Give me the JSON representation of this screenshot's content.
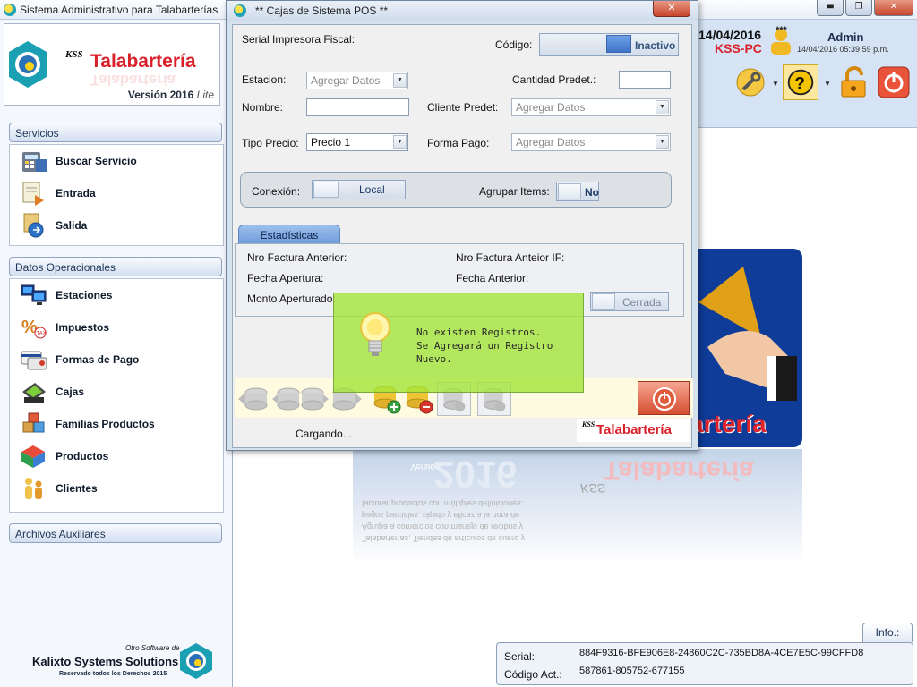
{
  "main_window": {
    "title": "Sistema Administrativo para Talabarterías",
    "controls": {
      "minimize": "▬",
      "maximize": "❐",
      "close": "✕"
    }
  },
  "logo": {
    "kss": "KSS",
    "name": "Talabartería",
    "version_label": "Versión 2016",
    "edition": "Lite"
  },
  "sidebar": {
    "servicios": {
      "header": "Servicios",
      "items": [
        {
          "label": "Buscar Servicio",
          "icon": "calculator-icon"
        },
        {
          "label": "Entrada",
          "icon": "document-in-icon"
        },
        {
          "label": "Salida",
          "icon": "document-out-icon"
        }
      ]
    },
    "datos": {
      "header": "Datos Operacionales",
      "items": [
        {
          "label": "Estaciones",
          "icon": "computers-icon"
        },
        {
          "label": "Impuestos",
          "icon": "percent-icon"
        },
        {
          "label": "Formas de Pago",
          "icon": "credit-card-icon"
        },
        {
          "label": "Cajas",
          "icon": "cash-register-icon"
        },
        {
          "label": "Familias Productos",
          "icon": "boxes-icon"
        },
        {
          "label": "Productos",
          "icon": "products-icon"
        },
        {
          "label": "Clientes",
          "icon": "people-icon"
        }
      ]
    },
    "auxiliares": {
      "header": "Archivos Auxiliares"
    }
  },
  "footer": {
    "small": "Otro Software de",
    "company": "Kalixto Systems Solutions",
    "rights": "Reservado todos los Derechos 2015"
  },
  "header": {
    "date": "14/04/2016",
    "pc": "KSS-PC",
    "stars": "***",
    "user": "Admin",
    "timestamp": "14/04/2016 05:39:59 p.m."
  },
  "splash": {
    "brand": "artería",
    "reflect_year": "2016",
    "reflect_version": "Versión",
    "reflect_brand": "Talabartería",
    "reflect_kss": "KSS",
    "reflect_lines": "Talabarterías, Tiendas de artículos de cuero y Agrupa a comercios con manejo de recibos y pagos parciales, rápido y eficaz a la hora de facturar productos con múltiples definiciones."
  },
  "info_tab": "Info.:",
  "serial": {
    "serial_label": "Serial:",
    "serial_value": "884F9316-BFE906E8-24860C2C-735BD8A-4CE7E5C-99CFFD8",
    "code_label": "Código Act.:",
    "code_value": "587861-805752-677155"
  },
  "pos_dialog": {
    "title": "** Cajas de Sistema POS **",
    "close": "✕",
    "serial_impresora": "Serial Impresora Fiscal:",
    "codigo_label": "Código:",
    "codigo_toggle": "Inactivo",
    "estacion_label": "Estacion:",
    "estacion_value": "Agregar Datos",
    "cantidad_label": "Cantidad Predet.:",
    "cantidad_value": "",
    "nombre_label": "Nombre:",
    "nombre_value": "",
    "cliente_label": "Cliente Predet:",
    "cliente_value": "Agregar Datos",
    "tipo_precio_label": "Tipo Precio:",
    "tipo_precio_value": "Precio 1",
    "forma_pago_label": "Forma Pago:",
    "forma_pago_value": "Agregar Datos",
    "conexion_label": "Conexión:",
    "conexion_value": "Local",
    "agrupar_label": "Agrupar Items:",
    "agrupar_value": "No",
    "stats_tab": "Estadísticas",
    "nro_factura_anterior": "Nro Factura Anterior:",
    "nro_factura_anterior_if": "Nro Factura Anteior IF:",
    "fecha_apertura": "Fecha Apertura:",
    "fecha_anterior": "Fecha Anterior:",
    "monto_aperturado": "Monto Aperturado:",
    "estado_toggle": "Cerrada",
    "toast": "No existen Registros.\nSe Agregará un Registro\nNuevo.",
    "status": "Cargando...",
    "brand_kss": "KSS",
    "brand_name": "Talabartería"
  },
  "colors": {
    "brand_red": "#d8212b",
    "toast_green": "#a1e434",
    "header_blue": "#d5e3f4"
  }
}
